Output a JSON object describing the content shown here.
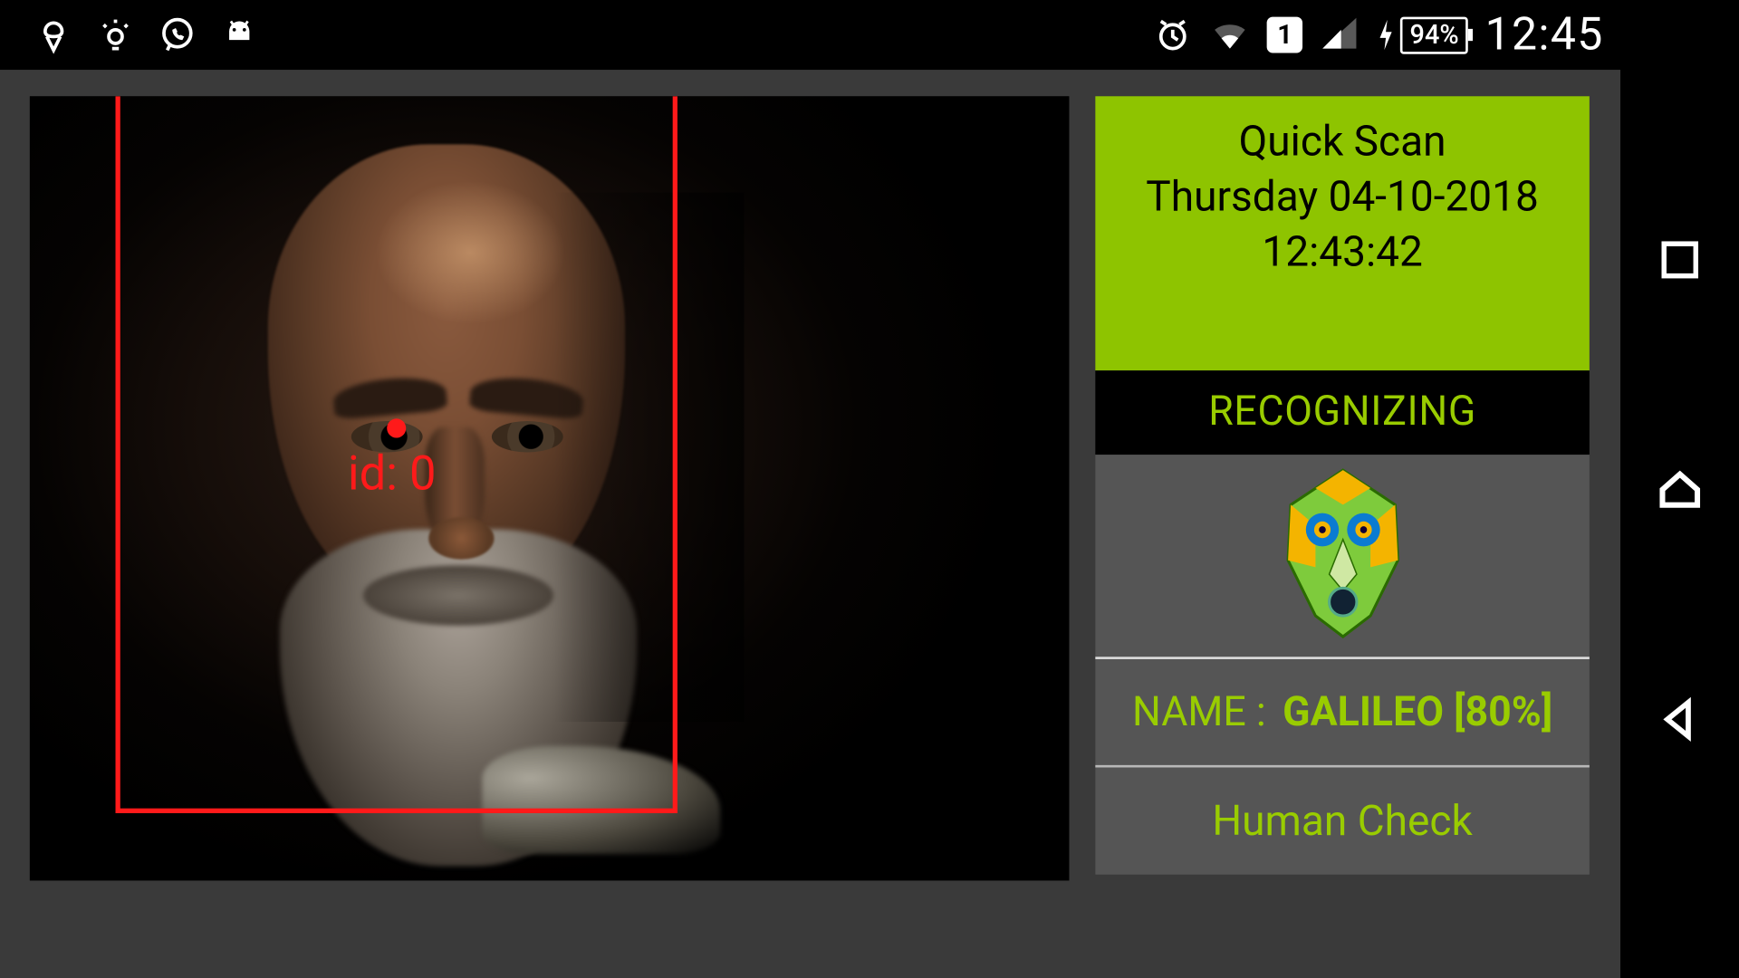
{
  "statusbar": {
    "clock": "12:45",
    "battery_pct": "94%",
    "sim_badge": "1"
  },
  "scan": {
    "title": "Quick Scan",
    "date_line": "Thursday 04-10-2018",
    "time_line": "12:43:42",
    "status": "RECOGNIZING",
    "name_label": "NAME :",
    "name_value": "GALILEO [80%]",
    "human_check": "Human Check"
  },
  "detection": {
    "id_label": "id: 0"
  },
  "colors": {
    "accent": "#99cc00",
    "accent_bright": "#8ec400",
    "detect_red": "#ff1a1a"
  }
}
